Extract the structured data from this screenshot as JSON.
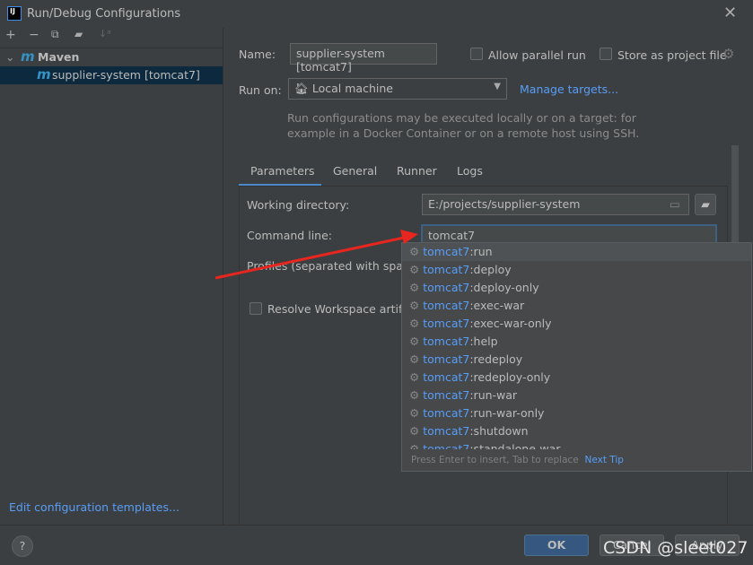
{
  "window": {
    "title": "Run/Debug Configurations",
    "app_logo": "IJ"
  },
  "toolbar": {
    "icons": [
      "plus-icon",
      "minus-icon",
      "copy-icon",
      "folder-add-icon",
      "sort-icon"
    ]
  },
  "tree": {
    "group": "Maven",
    "item": "supplier-system [tomcat7]"
  },
  "form": {
    "name_label": "Name:",
    "name_value": "supplier-system [tomcat7]",
    "allow_parallel": "Allow parallel run",
    "store_project": "Store as project file",
    "run_on_label": "Run on:",
    "run_on_value": "Local machine",
    "manage_targets": "Manage targets...",
    "hint_line1": "Run configurations may be executed locally or on a target: for",
    "hint_line2": "example in a Docker Container or on a remote host using SSH."
  },
  "tabs": [
    {
      "label": "Parameters",
      "active": true
    },
    {
      "label": "General"
    },
    {
      "label": "Runner"
    },
    {
      "label": "Logs"
    }
  ],
  "params": {
    "working_dir_label": "Working directory:",
    "working_dir_value": "E:/projects/supplier-system",
    "command_line_label": "Command line:",
    "command_line_value": "tomcat7",
    "profiles_label": "Profiles (separated with space",
    "resolve_label": "Resolve Workspace artifa"
  },
  "completion": {
    "prefix": "tomcat7",
    "items": [
      ":run",
      ":deploy",
      ":deploy-only",
      ":exec-war",
      ":exec-war-only",
      ":help",
      ":redeploy",
      ":redeploy-only",
      ":run-war",
      ":run-war-only",
      ":shutdown",
      ":standalone-war"
    ],
    "footer": "Press Enter to insert, Tab to replace",
    "next_tip": "Next Tip"
  },
  "footer": {
    "edit_templates": "Edit configuration templates...",
    "ok": "OK",
    "cancel": "Cancel",
    "apply": "Apply",
    "help": "?"
  },
  "watermark": "CSDN @sleet027",
  "colors": {
    "accent": "#589df6",
    "annotation_arrow": "#e8261f"
  }
}
